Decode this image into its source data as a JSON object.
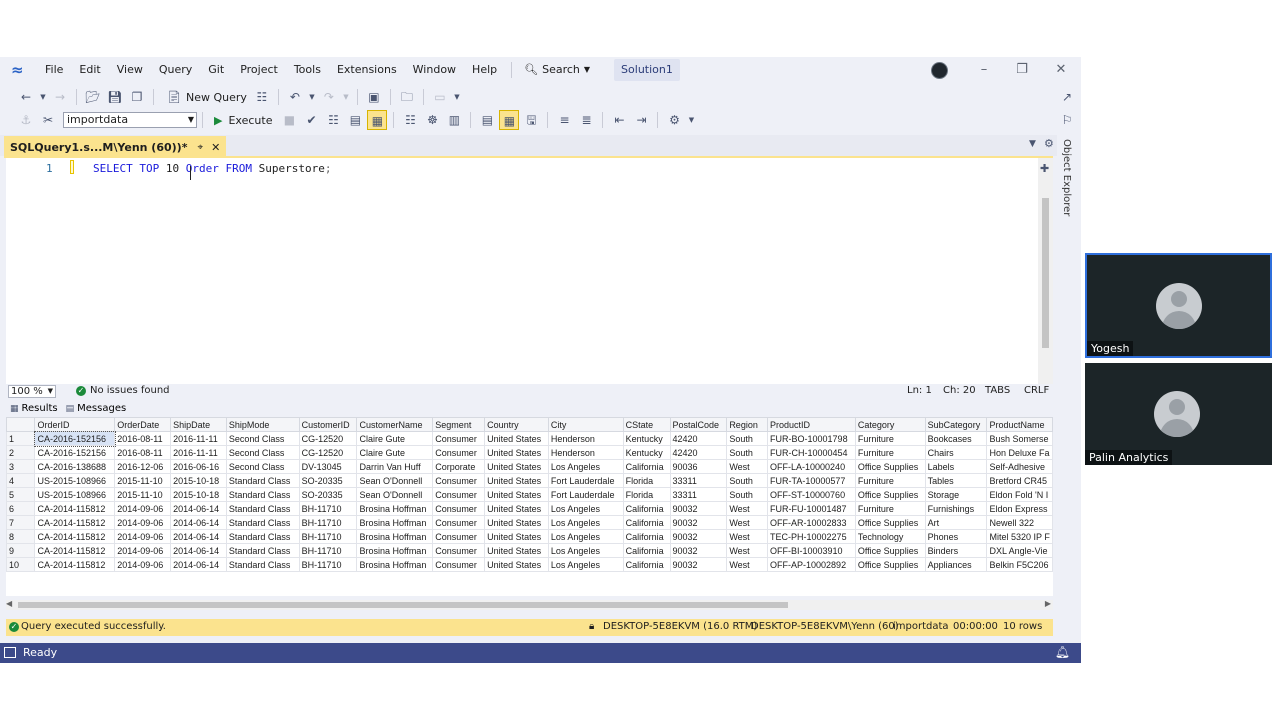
{
  "menu": {
    "items": [
      "File",
      "Edit",
      "View",
      "Query",
      "Git",
      "Project",
      "Tools",
      "Extensions",
      "Window",
      "Help"
    ],
    "search_label": "Search",
    "solution": "Solution1"
  },
  "toolbar": {
    "new_query_label": "New Query",
    "database": "importdata",
    "execute_label": "Execute"
  },
  "document_tab": {
    "title": "SQLQuery1.s...M\\Yenn (60))*"
  },
  "object_explorer_label": "Object Explorer",
  "editor": {
    "line_number": "1",
    "tokens": [
      {
        "text": "SELECT",
        "kind": "kw"
      },
      {
        "text": " ",
        "kind": "id"
      },
      {
        "text": "TOP",
        "kind": "kw"
      },
      {
        "text": " 10 ",
        "kind": "id"
      },
      {
        "text": "Order",
        "kind": "kw"
      },
      {
        "text": " ",
        "kind": "id"
      },
      {
        "text": "FROM",
        "kind": "kw"
      },
      {
        "text": " Superstore",
        "kind": "id"
      },
      {
        "text": ";",
        "kind": "punc"
      }
    ]
  },
  "editor_status": {
    "zoom": "100 %",
    "issues": "No issues found",
    "line": "Ln: 1",
    "column": "Ch: 20",
    "indent": "TABS",
    "line_ending": "CRLF"
  },
  "results_tabs": [
    "Results",
    "Messages"
  ],
  "grid": {
    "columns": [
      "OrderID",
      "OrderDate",
      "ShipDate",
      "ShipMode",
      "CustomerID",
      "CustomerName",
      "Segment",
      "Country",
      "City",
      "CState",
      "PostalCode",
      "Region",
      "ProductID",
      "Category",
      "SubCategory",
      "ProductName"
    ],
    "rows": [
      [
        "1",
        "CA-2016-152156",
        "2016-08-11",
        "2016-11-11",
        "Second Class",
        "CG-12520",
        "Claire Gute",
        "Consumer",
        "United States",
        "Henderson",
        "Kentucky",
        "42420",
        "South",
        "FUR-BO-10001798",
        "Furniture",
        "Bookcases",
        "Bush Somerse"
      ],
      [
        "2",
        "CA-2016-152156",
        "2016-08-11",
        "2016-11-11",
        "Second Class",
        "CG-12520",
        "Claire Gute",
        "Consumer",
        "United States",
        "Henderson",
        "Kentucky",
        "42420",
        "South",
        "FUR-CH-10000454",
        "Furniture",
        "Chairs",
        "Hon Deluxe Fa"
      ],
      [
        "3",
        "CA-2016-138688",
        "2016-12-06",
        "2016-06-16",
        "Second Class",
        "DV-13045",
        "Darrin Van Huff",
        "Corporate",
        "United States",
        "Los Angeles",
        "California",
        "90036",
        "West",
        "OFF-LA-10000240",
        "Office Supplies",
        "Labels",
        "Self-Adhesive"
      ],
      [
        "4",
        "US-2015-108966",
        "2015-11-10",
        "2015-10-18",
        "Standard Class",
        "SO-20335",
        "Sean O'Donnell",
        "Consumer",
        "United States",
        "Fort Lauderdale",
        "Florida",
        "33311",
        "South",
        "FUR-TA-10000577",
        "Furniture",
        "Tables",
        "Bretford CR45"
      ],
      [
        "5",
        "US-2015-108966",
        "2015-11-10",
        "2015-10-18",
        "Standard Class",
        "SO-20335",
        "Sean O'Donnell",
        "Consumer",
        "United States",
        "Fort Lauderdale",
        "Florida",
        "33311",
        "South",
        "OFF-ST-10000760",
        "Office Supplies",
        "Storage",
        "Eldon Fold 'N I"
      ],
      [
        "6",
        "CA-2014-115812",
        "2014-09-06",
        "2014-06-14",
        "Standard Class",
        "BH-11710",
        "Brosina Hoffman",
        "Consumer",
        "United States",
        "Los Angeles",
        "California",
        "90032",
        "West",
        "FUR-FU-10001487",
        "Furniture",
        "Furnishings",
        "Eldon Express"
      ],
      [
        "7",
        "CA-2014-115812",
        "2014-09-06",
        "2014-06-14",
        "Standard Class",
        "BH-11710",
        "Brosina Hoffman",
        "Consumer",
        "United States",
        "Los Angeles",
        "California",
        "90032",
        "West",
        "OFF-AR-10002833",
        "Office Supplies",
        "Art",
        "Newell 322"
      ],
      [
        "8",
        "CA-2014-115812",
        "2014-09-06",
        "2014-06-14",
        "Standard Class",
        "BH-11710",
        "Brosina Hoffman",
        "Consumer",
        "United States",
        "Los Angeles",
        "California",
        "90032",
        "West",
        "TEC-PH-10002275",
        "Technology",
        "Phones",
        "Mitel 5320 IP F"
      ],
      [
        "9",
        "CA-2014-115812",
        "2014-09-06",
        "2014-06-14",
        "Standard Class",
        "BH-11710",
        "Brosina Hoffman",
        "Consumer",
        "United States",
        "Los Angeles",
        "California",
        "90032",
        "West",
        "OFF-BI-10003910",
        "Office Supplies",
        "Binders",
        "DXL Angle-Vie"
      ],
      [
        "10",
        "CA-2014-115812",
        "2014-09-06",
        "2014-06-14",
        "Standard Class",
        "BH-11710",
        "Brosina Hoffman",
        "Consumer",
        "United States",
        "Los Angeles",
        "California",
        "90032",
        "West",
        "OFF-AP-10002892",
        "Office Supplies",
        "Appliances",
        "Belkin F5C206"
      ]
    ]
  },
  "query_status": {
    "message": "Query executed successfully.",
    "server": "DESKTOP-5E8EKVM (16.0 RTM)",
    "user": "DESKTOP-5E8EKVM\\Yenn (60)",
    "database": "importdata",
    "elapsed": "00:00:00",
    "rows": "10 rows"
  },
  "app_status": {
    "ready": "Ready"
  },
  "participants": [
    {
      "name": "Yogesh",
      "active": true
    },
    {
      "name": "Palin Analytics",
      "active": false
    }
  ],
  "colors": {
    "accent_tab": "#fbe38e",
    "status_bar": "#3c4a8a",
    "keyword": "#1a1adb",
    "active_speaker": "#2f6fdc"
  }
}
